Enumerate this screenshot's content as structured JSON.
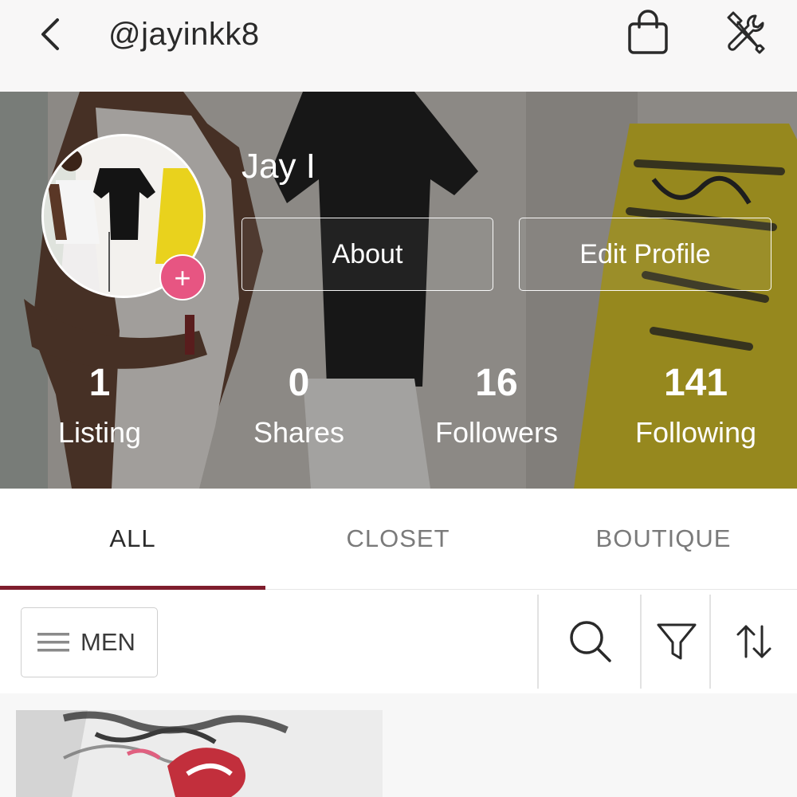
{
  "header": {
    "username": "@jayinkk8",
    "back_icon": "chevron-left-icon",
    "bag_icon": "shopping-bag-icon",
    "tools_icon": "tools-icon"
  },
  "profile": {
    "display_name": "Jay I",
    "avatar_add_symbol": "+",
    "about_label": "About",
    "edit_profile_label": "Edit Profile",
    "accent_color": "#e75582"
  },
  "stats": [
    {
      "value": "1",
      "label": "Listing"
    },
    {
      "value": "0",
      "label": "Shares"
    },
    {
      "value": "16",
      "label": "Followers"
    },
    {
      "value": "141",
      "label": "Following"
    }
  ],
  "tabs": [
    {
      "label": "ALL",
      "active": true
    },
    {
      "label": "CLOSET",
      "active": false
    },
    {
      "label": "BOUTIQUE",
      "active": false
    }
  ],
  "tab_indicator_color": "#7f1d2d",
  "filters": {
    "department_label": "MEN",
    "menu_icon": "hamburger-menu-icon",
    "search_icon": "search-icon",
    "filter_icon": "filter-funnel-icon",
    "sort_icon": "sort-arrows-icon"
  }
}
